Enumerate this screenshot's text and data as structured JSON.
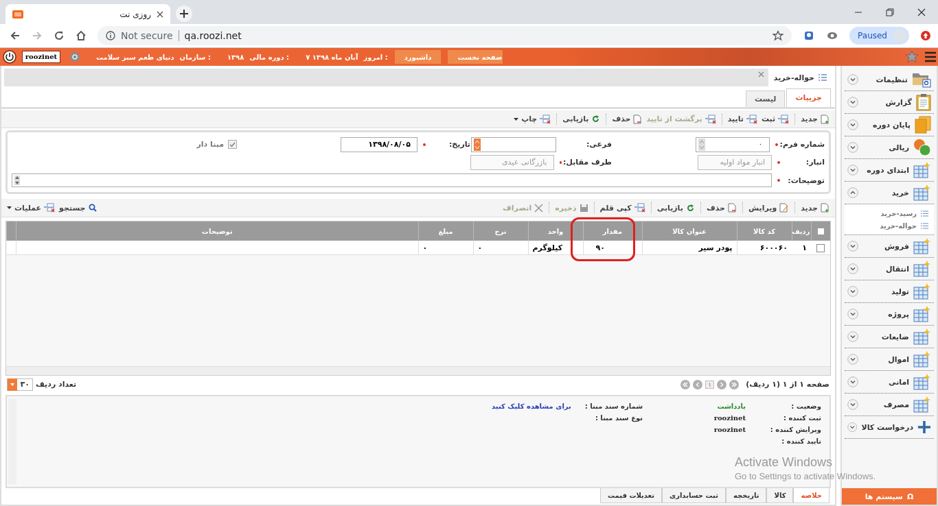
{
  "browser": {
    "tab_title": "روزی نت",
    "security": "Not secure",
    "address": "qa.roozi.net",
    "profile_label": "Paused"
  },
  "header": {
    "user": "roozinet",
    "info": [
      {
        "label": "امروز :",
        "value": "۷ آبان ماه ۱۳۹۸"
      },
      {
        "label": "دوره مالی :",
        "value": "۱۳۹۸"
      },
      {
        "label": "سازمان :",
        "value": "دنیای طعم سبز سلامت"
      }
    ],
    "buttons": [
      "صفحه نخست",
      "داشبورد"
    ]
  },
  "document_tab": {
    "title": "حواله-خرید"
  },
  "subtabs": [
    {
      "label": "جزییات",
      "selected": true
    },
    {
      "label": "لیست",
      "selected": false
    }
  ],
  "toolbar": [
    {
      "label": "جدید",
      "disabled": false,
      "dropdown": false
    },
    {
      "label": "ثبت",
      "disabled": false,
      "dropdown": false
    },
    {
      "label": "تایید",
      "disabled": false,
      "dropdown": false
    },
    {
      "label": "برگشت از تایید",
      "disabled": true,
      "dropdown": false
    },
    {
      "label": "حذف",
      "disabled": false,
      "dropdown": false
    },
    {
      "label": "بازیابی",
      "disabled": false,
      "dropdown": false
    },
    {
      "label": "چاپ",
      "disabled": false,
      "dropdown": true
    }
  ],
  "form": {
    "rows": [
      [
        {
          "label": "شماره فرم:",
          "required": true,
          "value": "۰",
          "disabled": false,
          "kind": "spinner"
        },
        {
          "label": "فرعی:",
          "required": false,
          "disabled": false,
          "kind": "combo"
        },
        {
          "label": "تاریخ:",
          "required": true,
          "value": "۱۳۹۸/۰۸/۰۵",
          "disabled": false,
          "kind": "text"
        }
      ],
      [
        {
          "label": "انبار:",
          "required": true,
          "value": "انبار مواد اولیه",
          "disabled": true,
          "kind": "text"
        },
        {
          "label": "طرف مقابل:",
          "required": true,
          "value": "بازرگانی عیدی",
          "disabled": true,
          "kind": "text"
        }
      ],
      [
        {
          "label": "توضیحات:",
          "required": true,
          "disabled": false,
          "kind": "textarea"
        }
      ]
    ],
    "checkbox": {
      "label": "مبنا دار",
      "checked": true,
      "disabled": true
    }
  },
  "grid_toolbar": {
    "items": [
      {
        "label": "جدید",
        "disabled": false
      },
      {
        "label": "ویرایش",
        "disabled": false
      },
      {
        "label": "حذف",
        "disabled": false
      },
      {
        "label": "بازیابی",
        "disabled": false
      },
      {
        "label": "کپی قلم",
        "disabled": false
      },
      {
        "label": "ذخیره",
        "disabled": true
      },
      {
        "label": "انصراف",
        "disabled": true
      }
    ],
    "search": "جستجو",
    "operations": "عملیات"
  },
  "table": {
    "columns": [
      {
        "label": "ردیف",
        "highlighted": false
      },
      {
        "label": "کد کالا",
        "highlighted": false
      },
      {
        "label": "عنوان کالا",
        "highlighted": false
      },
      {
        "label": "مقدار",
        "highlighted": true
      },
      {
        "label": "واحد",
        "highlighted": false
      },
      {
        "label": "نرخ",
        "highlighted": false
      },
      {
        "label": "مبلغ",
        "highlighted": false
      },
      {
        "label": "توضیحات",
        "highlighted": false
      }
    ],
    "select_all_checked": false,
    "rows": [
      {
        "checked": false,
        "cells": [
          "۱",
          "۶۰۰۰۶۰",
          "پودر سیر",
          "۹۰",
          "کیلوگرم",
          "۰",
          "۰"
        ]
      }
    ]
  },
  "pager": {
    "summary": "صفحه ۱ از ۱ (۱ ردیف)",
    "current_page": "۱",
    "page_size": "۳۰",
    "page_size_label": "تعداد ردیف"
  },
  "summary": {
    "left": [
      {
        "label": "وضعیت :",
        "value": "یادداشت",
        "kind": "status"
      },
      {
        "label": "ثبت کننده :",
        "value": "roozinet",
        "kind": "user"
      },
      {
        "label": "ویرایش کننده :",
        "value": "roozinet",
        "kind": "user"
      },
      {
        "label": "تایید کننده :"
      }
    ],
    "right": [
      {
        "label": "شماره سند مبنا :",
        "link": "برای مشاهده کلیک کنید"
      },
      {
        "label": "نوع سند مبنا :"
      }
    ]
  },
  "bottom_tabs": [
    {
      "label": "خلاصه",
      "selected": true
    },
    {
      "label": "کالا",
      "selected": false
    },
    {
      "label": "تاریخچه",
      "selected": false
    },
    {
      "label": "ثبت حسابداری",
      "selected": false
    },
    {
      "label": "تعدیلات قیمت",
      "selected": false
    }
  ],
  "sidebar": {
    "items": [
      {
        "label": "تنظیمات",
        "expanded": false
      },
      {
        "label": "گزارش",
        "expanded": false
      },
      {
        "label": "پایان دوره",
        "expanded": false
      },
      {
        "label": "ریالی",
        "expanded": false
      },
      {
        "label": "ابتدای دوره",
        "expanded": false
      },
      {
        "label": "خرید",
        "expanded": true,
        "children": [
          {
            "label": "رسید-خرید"
          },
          {
            "label": "حواله-خرید"
          }
        ]
      },
      {
        "label": "فروش",
        "expanded": false
      },
      {
        "label": "انتقال",
        "expanded": false
      },
      {
        "label": "تولید",
        "expanded": false
      },
      {
        "label": "پروژه",
        "expanded": false
      },
      {
        "label": "ضایعات",
        "expanded": false
      },
      {
        "label": "اموال",
        "expanded": false
      },
      {
        "label": "امانی",
        "expanded": false
      },
      {
        "label": "مصرف",
        "expanded": false
      },
      {
        "label": "درخواست کالا",
        "expanded": false
      }
    ],
    "footer_glyph": "Ω",
    "footer_label": "سیستم ها"
  },
  "os_notice": {
    "title": "Activate Windows",
    "detail": "Go to Settings to activate Windows."
  }
}
